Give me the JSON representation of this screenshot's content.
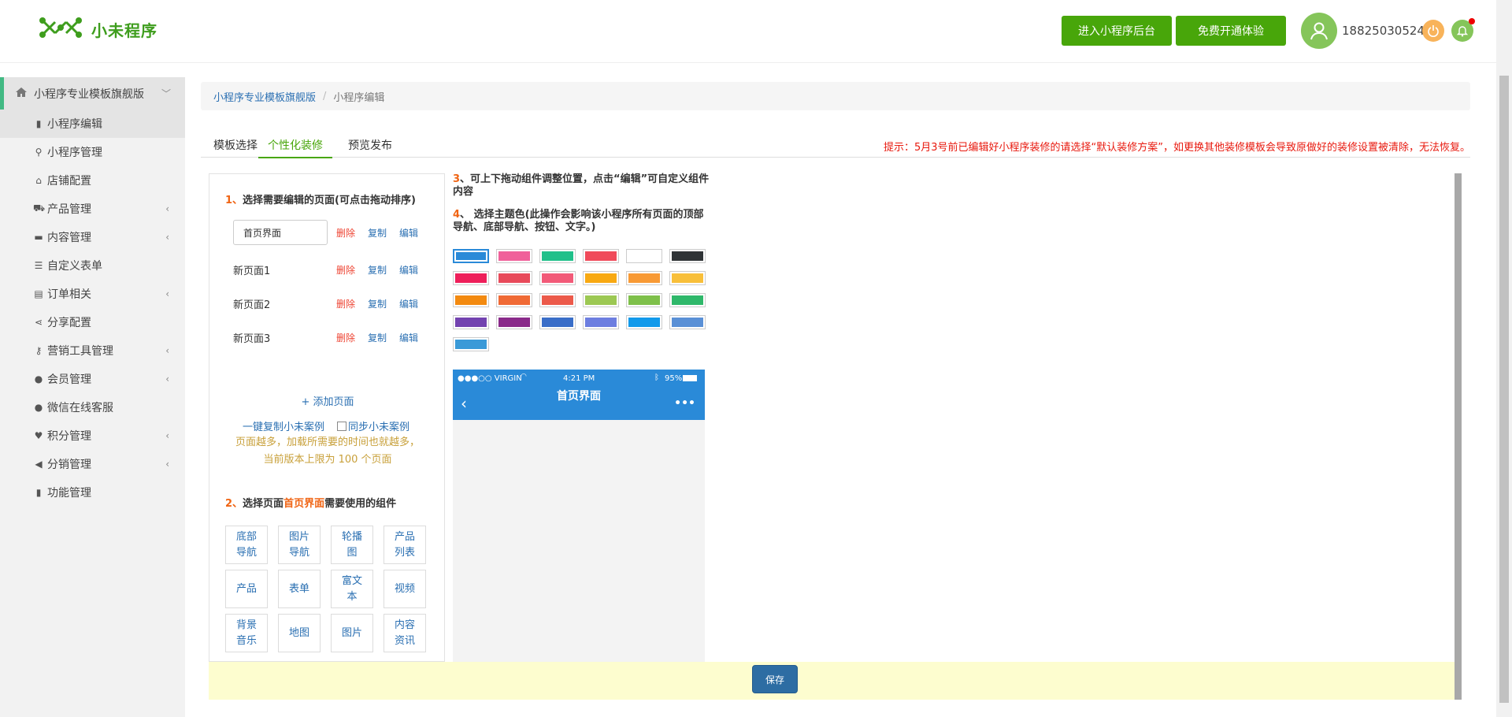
{
  "header": {
    "logo_text": "小未程序",
    "btn_admin": "进入小程序后台",
    "btn_free": "免费开通体验",
    "phone": "18825030524"
  },
  "sidebar": {
    "top": "小程序专业模板旗舰版",
    "items": [
      {
        "label": "小程序编辑",
        "icon": "book-icon",
        "arrow": false,
        "active": true
      },
      {
        "label": "小程序管理",
        "icon": "wrench-icon",
        "arrow": false
      },
      {
        "label": "店铺配置",
        "icon": "home-icon",
        "arrow": false
      },
      {
        "label": "产品管理",
        "icon": "cart-icon",
        "arrow": true
      },
      {
        "label": "内容管理",
        "icon": "folder-icon",
        "arrow": true
      },
      {
        "label": "自定义表单",
        "icon": "list-icon",
        "arrow": false
      },
      {
        "label": "订单相关",
        "icon": "doc-icon",
        "arrow": true
      },
      {
        "label": "分享配置",
        "icon": "share-icon",
        "arrow": false
      },
      {
        "label": "营销工具管理",
        "icon": "key-icon",
        "arrow": true
      },
      {
        "label": "会员管理",
        "icon": "user-icon",
        "arrow": true
      },
      {
        "label": "微信在线客服",
        "icon": "user-icon",
        "arrow": false
      },
      {
        "label": "积分管理",
        "icon": "heart-icon",
        "arrow": true
      },
      {
        "label": "分销管理",
        "icon": "megaphone-icon",
        "arrow": true
      },
      {
        "label": "功能管理",
        "icon": "book-icon",
        "arrow": false
      }
    ]
  },
  "breadcrumb": {
    "item1": "小程序专业模板旗舰版",
    "sep": "/",
    "item2": "小程序编辑"
  },
  "tabs": [
    "模板选择",
    "个性化装修",
    "预览发布"
  ],
  "tip": "提示：5月3号前已编辑好小程序装修的请选择“默认装修方案”，如更换其他装修模板会导致原做好的装修设置被清除，无法恢复。",
  "left": {
    "step1_num": "1、",
    "step1": "选择需要编辑的页面(可点击拖动排序)",
    "pages": [
      "首页界面",
      "新页面1",
      "新页面2",
      "新页面3"
    ],
    "del": "删除",
    "copy": "复制",
    "edit": "编辑",
    "add_page": "+ 添加页面",
    "copy_case": "一键复制小未案例",
    "sync_case": "同步小未案例",
    "note1": "页面越多，加载所需要的时间也就越多，",
    "note2": "当前版本上限为 100 个页面",
    "step2_num": "2、",
    "step2_a": "选择页面",
    "step2_hl": "首页界面",
    "step2_b": "需要使用的组件",
    "components": [
      "底部导航",
      "图片导航",
      "轮播图",
      "产品列表",
      "产品",
      "表单",
      "富文本",
      "视频",
      "背景音乐",
      "地图",
      "图片",
      "内容资讯"
    ]
  },
  "mid": {
    "step3_num": "3",
    "step3": "、可上下拖动组件调整位置，点击“编辑”可自定义组件内容",
    "step4_num": "4",
    "step4": "、 选择主题色(此操作会影响该小程序所有页面的顶部导航、底部导航、按钮、文字。)",
    "colors": [
      "#2a8ad8",
      "#f0609a",
      "#20c08a",
      "#f04a5a",
      "#ffffff",
      "#2f3336",
      "#ee1f5a",
      "#e84a5a",
      "#f25a78",
      "#f8a912",
      "#f89a35",
      "#f8bf3a",
      "#f38a10",
      "#f06a35",
      "#ec5a4a",
      "#9cc853",
      "#7ec04a",
      "#2fb86a",
      "#7343b0",
      "#8a2a8a",
      "#3a6ec8",
      "#6d7ee0",
      "#129aeb",
      "#5a90d6",
      "#3a9ad8"
    ],
    "phone_status_left": "●●●○○ VIRGIN",
    "phone_status_time": "4:21 PM",
    "phone_status_right": "95%",
    "phone_title": "首页界面",
    "phone_more": "•••"
  },
  "save": "保存"
}
